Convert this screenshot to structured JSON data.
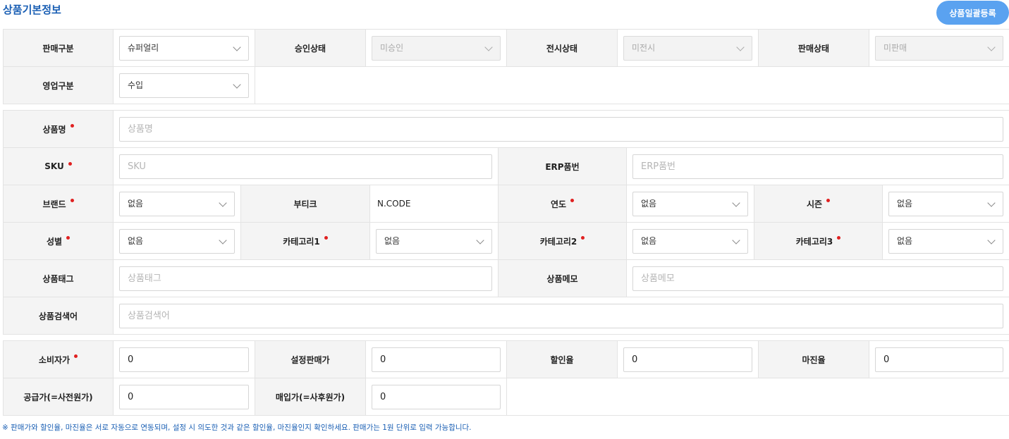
{
  "header": {
    "title": "상품기본정보",
    "bulk_button": "상품일괄등록"
  },
  "section1": {
    "sale_type": {
      "label": "판매구분",
      "value": "슈퍼얼리"
    },
    "approval_status": {
      "label": "승인상태",
      "value": "미승인"
    },
    "display_status": {
      "label": "전시상태",
      "value": "미전시"
    },
    "sale_status": {
      "label": "판매상태",
      "value": "미판매"
    },
    "business_type": {
      "label": "영업구분",
      "value": "수입"
    }
  },
  "section2": {
    "product_name": {
      "label": "상품명",
      "placeholder": "상품명"
    },
    "sku": {
      "label": "SKU",
      "placeholder": "SKU"
    },
    "erp_code": {
      "label": "ERP품번",
      "placeholder": "ERP품번"
    },
    "brand": {
      "label": "브랜드",
      "value": "없음"
    },
    "boutique": {
      "label": "부티크",
      "value": "N.CODE"
    },
    "year": {
      "label": "연도",
      "value": "없음"
    },
    "season": {
      "label": "시즌",
      "value": "없음"
    },
    "gender": {
      "label": "성별",
      "value": "없음"
    },
    "category1": {
      "label": "카테고리1",
      "value": "없음"
    },
    "category2": {
      "label": "카테고리2",
      "value": "없음"
    },
    "category3": {
      "label": "카테고리3",
      "value": "없음"
    },
    "product_tag": {
      "label": "상품태그",
      "placeholder": "상품태그"
    },
    "product_memo": {
      "label": "상품메모",
      "placeholder": "상품메모"
    },
    "search_keywords": {
      "label": "상품검색어",
      "placeholder": "상품검색어"
    }
  },
  "section3": {
    "consumer_price": {
      "label": "소비자가",
      "value": "0"
    },
    "set_sale_price": {
      "label": "설정판매가",
      "value": "0"
    },
    "discount_rate": {
      "label": "할인율",
      "value": "0"
    },
    "margin_rate": {
      "label": "마진율",
      "value": "0"
    },
    "supply_price": {
      "label": "공급가(=사전원가)",
      "value": "0"
    },
    "purchase_price": {
      "label": "매입가(=사후원가)",
      "value": "0"
    }
  },
  "footnote": "※ 판매가와 할인율, 마진율은 서로 자동으로 연동되며, 설정 시 의도한 것과 같은 할인율, 마진율인지 확인하세요. 판매가는 1원 단위로 입력 가능합니다.",
  "colors": {
    "accent": "#1a5fb4",
    "button": "#5aa2f0",
    "required_dot": "#e02020",
    "label_bg": "#f4f4f4"
  }
}
